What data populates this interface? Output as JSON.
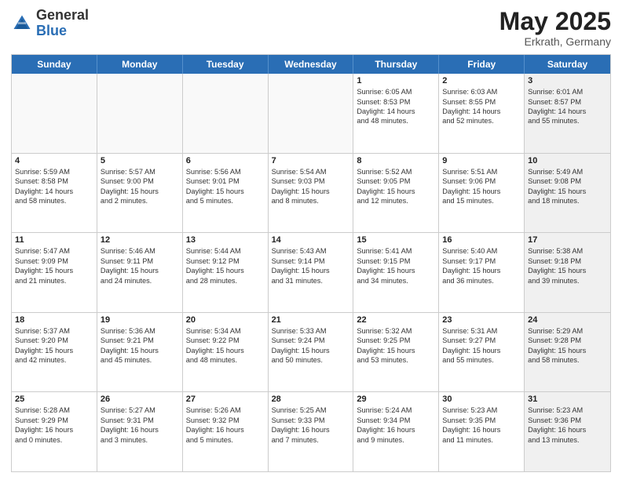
{
  "header": {
    "logo_general": "General",
    "logo_blue": "Blue",
    "month": "May 2025",
    "location": "Erkrath, Germany"
  },
  "weekdays": [
    "Sunday",
    "Monday",
    "Tuesday",
    "Wednesday",
    "Thursday",
    "Friday",
    "Saturday"
  ],
  "rows": [
    [
      {
        "day": "",
        "lines": [],
        "empty": true
      },
      {
        "day": "",
        "lines": [],
        "empty": true
      },
      {
        "day": "",
        "lines": [],
        "empty": true
      },
      {
        "day": "",
        "lines": [],
        "empty": true
      },
      {
        "day": "1",
        "lines": [
          "Sunrise: 6:05 AM",
          "Sunset: 8:53 PM",
          "Daylight: 14 hours",
          "and 48 minutes."
        ]
      },
      {
        "day": "2",
        "lines": [
          "Sunrise: 6:03 AM",
          "Sunset: 8:55 PM",
          "Daylight: 14 hours",
          "and 52 minutes."
        ]
      },
      {
        "day": "3",
        "lines": [
          "Sunrise: 6:01 AM",
          "Sunset: 8:57 PM",
          "Daylight: 14 hours",
          "and 55 minutes."
        ],
        "shaded": true
      }
    ],
    [
      {
        "day": "4",
        "lines": [
          "Sunrise: 5:59 AM",
          "Sunset: 8:58 PM",
          "Daylight: 14 hours",
          "and 58 minutes."
        ]
      },
      {
        "day": "5",
        "lines": [
          "Sunrise: 5:57 AM",
          "Sunset: 9:00 PM",
          "Daylight: 15 hours",
          "and 2 minutes."
        ]
      },
      {
        "day": "6",
        "lines": [
          "Sunrise: 5:56 AM",
          "Sunset: 9:01 PM",
          "Daylight: 15 hours",
          "and 5 minutes."
        ]
      },
      {
        "day": "7",
        "lines": [
          "Sunrise: 5:54 AM",
          "Sunset: 9:03 PM",
          "Daylight: 15 hours",
          "and 8 minutes."
        ]
      },
      {
        "day": "8",
        "lines": [
          "Sunrise: 5:52 AM",
          "Sunset: 9:05 PM",
          "Daylight: 15 hours",
          "and 12 minutes."
        ]
      },
      {
        "day": "9",
        "lines": [
          "Sunrise: 5:51 AM",
          "Sunset: 9:06 PM",
          "Daylight: 15 hours",
          "and 15 minutes."
        ]
      },
      {
        "day": "10",
        "lines": [
          "Sunrise: 5:49 AM",
          "Sunset: 9:08 PM",
          "Daylight: 15 hours",
          "and 18 minutes."
        ],
        "shaded": true
      }
    ],
    [
      {
        "day": "11",
        "lines": [
          "Sunrise: 5:47 AM",
          "Sunset: 9:09 PM",
          "Daylight: 15 hours",
          "and 21 minutes."
        ]
      },
      {
        "day": "12",
        "lines": [
          "Sunrise: 5:46 AM",
          "Sunset: 9:11 PM",
          "Daylight: 15 hours",
          "and 24 minutes."
        ]
      },
      {
        "day": "13",
        "lines": [
          "Sunrise: 5:44 AM",
          "Sunset: 9:12 PM",
          "Daylight: 15 hours",
          "and 28 minutes."
        ]
      },
      {
        "day": "14",
        "lines": [
          "Sunrise: 5:43 AM",
          "Sunset: 9:14 PM",
          "Daylight: 15 hours",
          "and 31 minutes."
        ]
      },
      {
        "day": "15",
        "lines": [
          "Sunrise: 5:41 AM",
          "Sunset: 9:15 PM",
          "Daylight: 15 hours",
          "and 34 minutes."
        ]
      },
      {
        "day": "16",
        "lines": [
          "Sunrise: 5:40 AM",
          "Sunset: 9:17 PM",
          "Daylight: 15 hours",
          "and 36 minutes."
        ]
      },
      {
        "day": "17",
        "lines": [
          "Sunrise: 5:38 AM",
          "Sunset: 9:18 PM",
          "Daylight: 15 hours",
          "and 39 minutes."
        ],
        "shaded": true
      }
    ],
    [
      {
        "day": "18",
        "lines": [
          "Sunrise: 5:37 AM",
          "Sunset: 9:20 PM",
          "Daylight: 15 hours",
          "and 42 minutes."
        ]
      },
      {
        "day": "19",
        "lines": [
          "Sunrise: 5:36 AM",
          "Sunset: 9:21 PM",
          "Daylight: 15 hours",
          "and 45 minutes."
        ]
      },
      {
        "day": "20",
        "lines": [
          "Sunrise: 5:34 AM",
          "Sunset: 9:22 PM",
          "Daylight: 15 hours",
          "and 48 minutes."
        ]
      },
      {
        "day": "21",
        "lines": [
          "Sunrise: 5:33 AM",
          "Sunset: 9:24 PM",
          "Daylight: 15 hours",
          "and 50 minutes."
        ]
      },
      {
        "day": "22",
        "lines": [
          "Sunrise: 5:32 AM",
          "Sunset: 9:25 PM",
          "Daylight: 15 hours",
          "and 53 minutes."
        ]
      },
      {
        "day": "23",
        "lines": [
          "Sunrise: 5:31 AM",
          "Sunset: 9:27 PM",
          "Daylight: 15 hours",
          "and 55 minutes."
        ]
      },
      {
        "day": "24",
        "lines": [
          "Sunrise: 5:29 AM",
          "Sunset: 9:28 PM",
          "Daylight: 15 hours",
          "and 58 minutes."
        ],
        "shaded": true
      }
    ],
    [
      {
        "day": "25",
        "lines": [
          "Sunrise: 5:28 AM",
          "Sunset: 9:29 PM",
          "Daylight: 16 hours",
          "and 0 minutes."
        ]
      },
      {
        "day": "26",
        "lines": [
          "Sunrise: 5:27 AM",
          "Sunset: 9:31 PM",
          "Daylight: 16 hours",
          "and 3 minutes."
        ]
      },
      {
        "day": "27",
        "lines": [
          "Sunrise: 5:26 AM",
          "Sunset: 9:32 PM",
          "Daylight: 16 hours",
          "and 5 minutes."
        ]
      },
      {
        "day": "28",
        "lines": [
          "Sunrise: 5:25 AM",
          "Sunset: 9:33 PM",
          "Daylight: 16 hours",
          "and 7 minutes."
        ]
      },
      {
        "day": "29",
        "lines": [
          "Sunrise: 5:24 AM",
          "Sunset: 9:34 PM",
          "Daylight: 16 hours",
          "and 9 minutes."
        ]
      },
      {
        "day": "30",
        "lines": [
          "Sunrise: 5:23 AM",
          "Sunset: 9:35 PM",
          "Daylight: 16 hours",
          "and 11 minutes."
        ]
      },
      {
        "day": "31",
        "lines": [
          "Sunrise: 5:23 AM",
          "Sunset: 9:36 PM",
          "Daylight: 16 hours",
          "and 13 minutes."
        ],
        "shaded": true
      }
    ]
  ]
}
